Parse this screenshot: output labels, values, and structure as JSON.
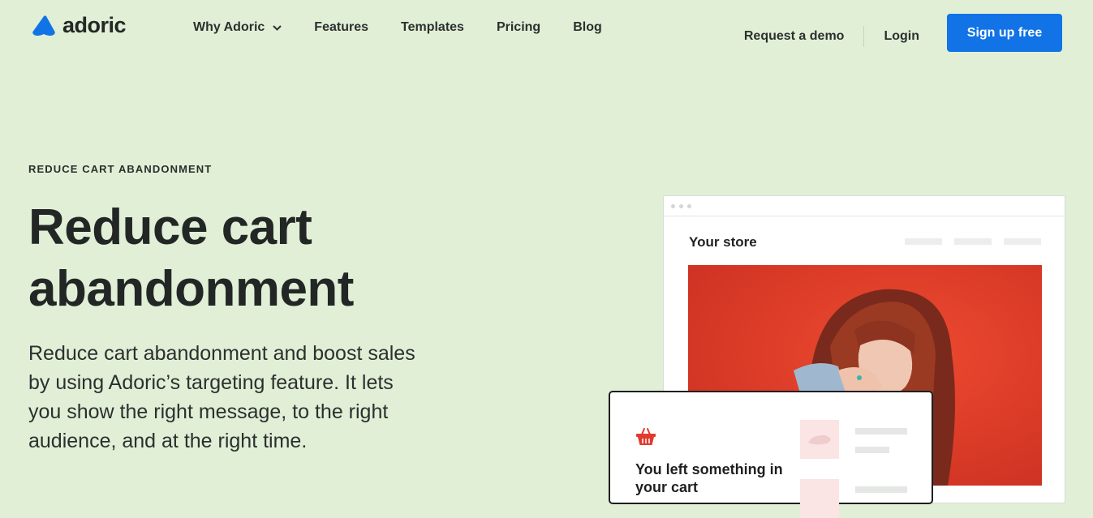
{
  "header": {
    "logo_text": "adoric",
    "nav": [
      {
        "label": "Why Adoric",
        "has_dropdown": true
      },
      {
        "label": "Features"
      },
      {
        "label": "Templates"
      },
      {
        "label": "Pricing"
      },
      {
        "label": "Blog"
      }
    ],
    "request_demo": "Request a demo",
    "login": "Login",
    "signup": "Sign up free"
  },
  "hero": {
    "eyebrow": "REDUCE CART ABANDONMENT",
    "headline_line1": "Reduce cart",
    "headline_line2": "abandonment",
    "description": "Reduce cart abandonment and boost sales by using Adoric’s targeting feature. It lets you show the right message, to the right audience, and at the right time."
  },
  "mockup": {
    "store_title": "Your store",
    "popup_title": "You left something in your cart"
  },
  "colors": {
    "background": "#e1efd6",
    "brand_blue": "#1173e6",
    "hero_image_red": "#e2402b",
    "basket_red": "#e03b2e"
  }
}
